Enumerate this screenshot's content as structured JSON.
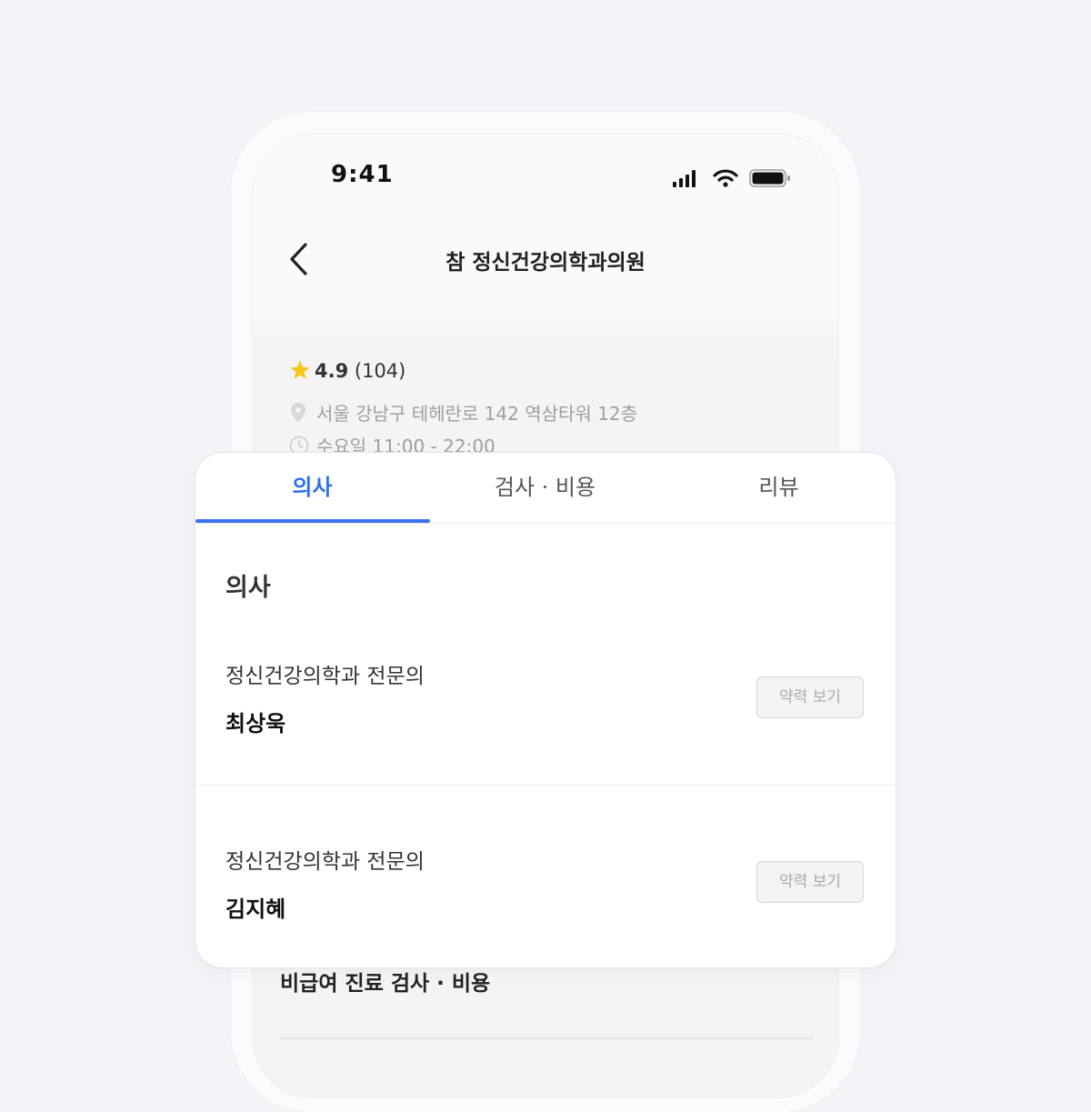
{
  "status_bar": {
    "time": "9:41"
  },
  "nav": {
    "title": "참 정신건강의학과의원"
  },
  "clinic": {
    "rating": "4.9",
    "review_count": "(104)",
    "address": "서울 강남구 테헤란로 142 역삼타워 12층",
    "hours": "수요일 11:00 - 22:00"
  },
  "tabs": [
    {
      "label": "의사",
      "active": true
    },
    {
      "label": "검사 · 비용",
      "active": false
    },
    {
      "label": "리뷰",
      "active": false
    }
  ],
  "doctors_section": {
    "title": "의사",
    "doctors": [
      {
        "specialty": "정신건강의학과 전문의",
        "name": "최상욱",
        "button": "약력 보기"
      },
      {
        "specialty": "정신건강의학과 전문의",
        "name": "김지혜",
        "button": "약력 보기"
      }
    ]
  },
  "below_card": {
    "heading": "비급여 진료 검사 · 비용"
  },
  "colors": {
    "accent": "#3b74ee",
    "star": "#f5c518",
    "background": "#f3f4f7"
  }
}
